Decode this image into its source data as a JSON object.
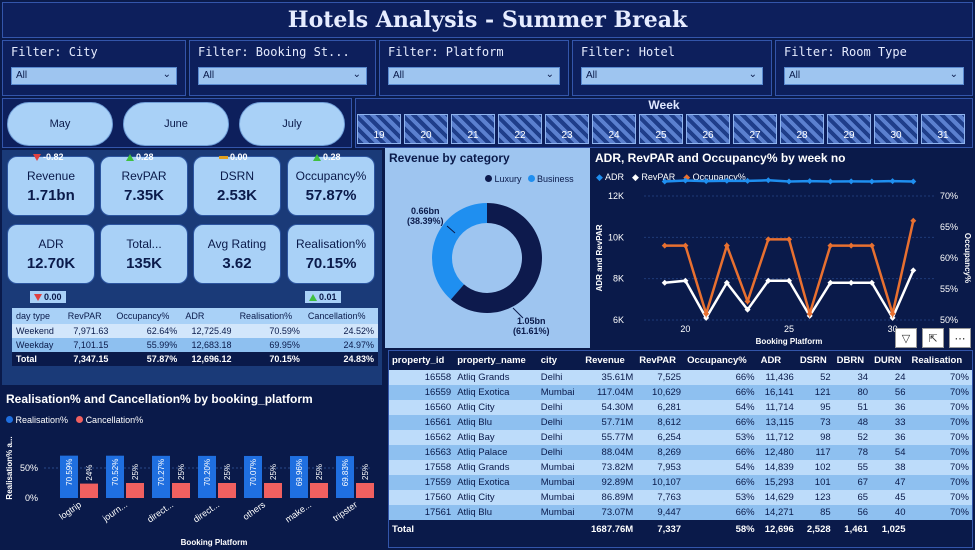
{
  "title": "Hotels Analysis - Summer Break",
  "filters": [
    {
      "label": "Filter: City",
      "value": "All"
    },
    {
      "label": "Filter: Booking St...",
      "value": "All"
    },
    {
      "label": "Filter: Platform",
      "value": "All"
    },
    {
      "label": "Filter: Hotel",
      "value": "All"
    },
    {
      "label": "Filter: Room Type",
      "value": "All"
    }
  ],
  "months": [
    "May",
    "June",
    "July"
  ],
  "week": {
    "title": "Week",
    "numbers": [
      "19",
      "20",
      "21",
      "22",
      "23",
      "24",
      "25",
      "26",
      "27",
      "28",
      "29",
      "30",
      "31"
    ]
  },
  "kpis": [
    {
      "label": "Revenue",
      "value": "1.71bn",
      "delta": "-0.82",
      "trend": "down"
    },
    {
      "label": "RevPAR",
      "value": "7.35K",
      "delta": "0.28",
      "trend": "up"
    },
    {
      "label": "DSRN",
      "value": "2.53K",
      "delta": "0.00",
      "trend": "flat"
    },
    {
      "label": "Occupancy%",
      "value": "57.87%",
      "delta": "0.28",
      "trend": "up"
    },
    {
      "label": "ADR",
      "value": "12.70K",
      "delta": "",
      "trend": ""
    },
    {
      "label": "Total...",
      "value": "135K",
      "delta": "",
      "trend": ""
    },
    {
      "label": "Avg Rating",
      "value": "3.62",
      "delta": "",
      "trend": ""
    },
    {
      "label": "Realisation%",
      "value": "70.15%",
      "delta": "",
      "trend": ""
    }
  ],
  "adr_delta": "0.00",
  "cancel_delta": "0.01",
  "daytype_table": {
    "headers": [
      "day type",
      "RevPAR",
      "Occupancy%",
      "ADR",
      "Realisation%",
      "Cancellation%"
    ],
    "rows": [
      [
        "Weekend",
        "7,971.63",
        "62.64%",
        "12,725.49",
        "70.59%",
        "24.52%"
      ],
      [
        "Weekday",
        "7,101.15",
        "55.99%",
        "12,683.18",
        "69.95%",
        "24.97%"
      ]
    ],
    "total": [
      "Total",
      "7,347.15",
      "57.87%",
      "12,696.12",
      "70.15%",
      "24.83%"
    ]
  },
  "donut": {
    "title": "Revenue by category",
    "legend": [
      "Luxury",
      "Business"
    ],
    "colors": [
      "#0d1a4d",
      "#1f8ff0"
    ],
    "business_label": "0.66bn",
    "business_pct": "(38.39%)",
    "luxury_label": "1.05bn",
    "luxury_pct": "(61.61%)"
  },
  "line_chart": {
    "title": "ADR, RevPAR and Occupancy% by week no",
    "legend": [
      "ADR",
      "RevPAR",
      "Occupancy%"
    ],
    "xlabel": "Booking Platform",
    "ylabel_left": "ADR and RevPAR",
    "ylabel_right": "Occupancy%",
    "left_ticks": [
      "12K",
      "10K",
      "8K",
      "6K"
    ],
    "right_ticks": [
      "70%",
      "65%",
      "60%",
      "55%",
      "50%"
    ],
    "x_ticks": [
      "20",
      "25",
      "30"
    ]
  },
  "bar_chart": {
    "title": "Realisation% and Cancellation% by booking_platform",
    "legend": [
      "Realisation%",
      "Cancellation%"
    ],
    "ylabel": "Realisation% a...",
    "xlabel": "Booking Platform",
    "y_ticks": [
      "50%",
      "0%"
    ],
    "colors": [
      "#1f6fe0",
      "#f06060"
    ]
  },
  "chart_data": [
    {
      "type": "bar",
      "title": "Realisation% and Cancellation% by booking_platform",
      "categories": [
        "logtrip",
        "journ...",
        "direct...",
        "direct...",
        "others",
        "make...",
        "tripster"
      ],
      "series": [
        {
          "name": "Realisation%",
          "values": [
            70.59,
            70.52,
            70.27,
            70.2,
            70.07,
            69.96,
            69.83
          ]
        },
        {
          "name": "Cancellation%",
          "values": [
            24,
            25,
            25,
            25,
            25,
            25,
            25
          ]
        }
      ],
      "labels_realisation": [
        "70.59%",
        "70.52%",
        "70.27%",
        "70.20%",
        "70.07%",
        "69.96%",
        "69.83%"
      ],
      "labels_cancellation": [
        "24%",
        "25%",
        "25%",
        "25%",
        "25%",
        "25%",
        "25%"
      ],
      "ylim": [
        0,
        100
      ]
    },
    {
      "type": "line",
      "title": "ADR, RevPAR and Occupancy% by week no",
      "x": [
        19,
        20,
        21,
        22,
        23,
        24,
        25,
        26,
        27,
        28,
        29,
        30,
        31
      ],
      "series": [
        {
          "name": "ADR",
          "axis": "left",
          "values": [
            12700,
            12750,
            12720,
            12740,
            12730,
            12760,
            12700,
            12720,
            12700,
            12710,
            12700,
            12720,
            12700
          ]
        },
        {
          "name": "RevPAR",
          "axis": "left",
          "values": [
            7800,
            7900,
            6100,
            7800,
            6500,
            7900,
            7900,
            6200,
            7800,
            7800,
            7800,
            6100,
            8400
          ]
        },
        {
          "name": "Occupancy%",
          "axis": "right",
          "values": [
            62,
            62,
            51,
            62,
            53,
            63,
            63,
            51,
            62,
            62,
            62,
            51,
            66
          ]
        }
      ],
      "ylim_left": [
        6000,
        12000
      ],
      "ylim_right": [
        50,
        70
      ]
    },
    {
      "type": "pie",
      "title": "Revenue by category",
      "categories": [
        "Luxury",
        "Business"
      ],
      "values": [
        1.05,
        0.66
      ]
    }
  ],
  "property_table": {
    "headers": [
      "property_id",
      "property_name",
      "city",
      "Revenue",
      "RevPAR",
      "Occupancy%",
      "ADR",
      "DSRN",
      "DBRN",
      "DURN",
      "Realisation"
    ],
    "rows": [
      [
        "16558",
        "Atliq Grands",
        "Delhi",
        "35.61M",
        "7,525",
        "66%",
        "11,436",
        "52",
        "34",
        "24",
        "70%"
      ],
      [
        "16559",
        "Atliq Exotica",
        "Mumbai",
        "117.04M",
        "10,629",
        "66%",
        "16,141",
        "121",
        "80",
        "56",
        "70%"
      ],
      [
        "16560",
        "Atliq City",
        "Delhi",
        "54.30M",
        "6,281",
        "54%",
        "11,714",
        "95",
        "51",
        "36",
        "70%"
      ],
      [
        "16561",
        "Atliq Blu",
        "Delhi",
        "57.71M",
        "8,612",
        "66%",
        "13,115",
        "73",
        "48",
        "33",
        "70%"
      ],
      [
        "16562",
        "Atliq Bay",
        "Delhi",
        "55.77M",
        "6,254",
        "53%",
        "11,712",
        "98",
        "52",
        "36",
        "70%"
      ],
      [
        "16563",
        "Atliq Palace",
        "Delhi",
        "88.04M",
        "8,269",
        "66%",
        "12,480",
        "117",
        "78",
        "54",
        "70%"
      ],
      [
        "17558",
        "Atliq Grands",
        "Mumbai",
        "73.82M",
        "7,953",
        "54%",
        "14,839",
        "102",
        "55",
        "38",
        "70%"
      ],
      [
        "17559",
        "Atliq Exotica",
        "Mumbai",
        "92.89M",
        "10,107",
        "66%",
        "15,293",
        "101",
        "67",
        "47",
        "70%"
      ],
      [
        "17560",
        "Atliq City",
        "Mumbai",
        "86.89M",
        "7,763",
        "53%",
        "14,629",
        "123",
        "65",
        "45",
        "70%"
      ],
      [
        "17561",
        "Atliq Blu",
        "Mumbai",
        "73.07M",
        "9,447",
        "66%",
        "14,271",
        "85",
        "56",
        "40",
        "70%"
      ]
    ],
    "total": [
      "Total",
      "",
      "",
      "1687.76M",
      "7,337",
      "58%",
      "12,696",
      "2,528",
      "1,461",
      "1,025",
      ""
    ]
  }
}
